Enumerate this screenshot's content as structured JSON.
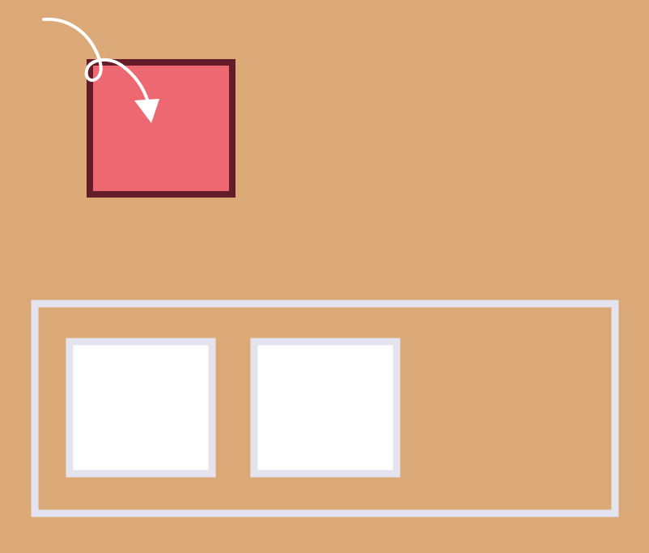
{
  "colors": {
    "background": "#dba878",
    "dragged_block_fill": "#ed6870",
    "dragged_block_border": "#641c2a",
    "arrow": "#ffffff",
    "container_border": "#e4e4f0",
    "slot_fill": "#ffffff",
    "slot_border": "#e4e4f0"
  },
  "icons": {
    "arrow": "curved-arrow-icon"
  },
  "container": {
    "slots": [
      {
        "state": "empty"
      },
      {
        "state": "empty"
      }
    ]
  }
}
